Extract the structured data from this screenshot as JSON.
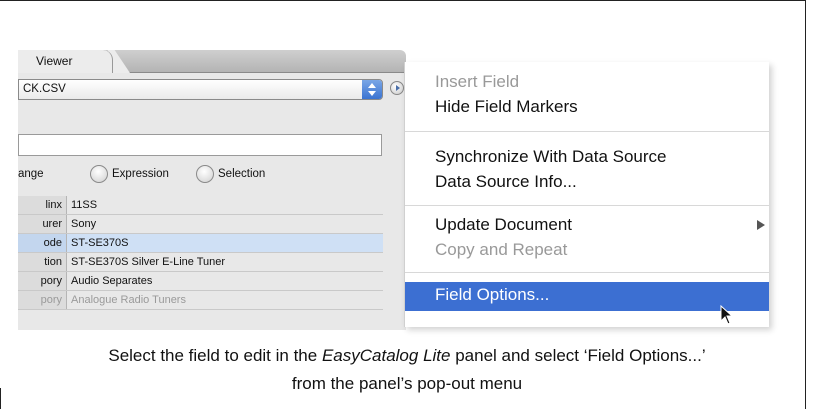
{
  "panel": {
    "tab_label": "Viewer",
    "data_source_file": "CK.CSV",
    "radio_labels": [
      "ange",
      "Expression",
      "Selection"
    ],
    "rows": [
      {
        "key": "linx",
        "value": "11SS"
      },
      {
        "key": "urer",
        "value": "Sony"
      },
      {
        "key": "ode",
        "value": "ST-SE370S",
        "selected": true
      },
      {
        "key": "tion",
        "value": "ST-SE370S Silver E-Line Tuner"
      },
      {
        "key": "pory",
        "value": "Audio Separates"
      },
      {
        "key": "pory",
        "value": "Analogue Radio Tuners"
      }
    ]
  },
  "menu": {
    "items": [
      {
        "label": "Insert Field",
        "disabled": true
      },
      {
        "label": "Hide Field Markers"
      },
      {
        "label": "Synchronize With Data Source"
      },
      {
        "label": "Data Source Info..."
      },
      {
        "label": "Update Document",
        "submenu": true
      },
      {
        "label": "Copy and Repeat",
        "disabled": true
      },
      {
        "label": "Field Options...",
        "highlighted": true
      }
    ]
  },
  "caption": {
    "line1_a": "Select the field to edit in the ",
    "line1_em": "EasyCatalog Lite",
    "line1_b": " panel and select ‘Field Options...’",
    "line2": "from the panel’s pop-out menu"
  },
  "colors": {
    "highlight": "#3c6fd2",
    "selection_row": "#cfe0f5"
  }
}
